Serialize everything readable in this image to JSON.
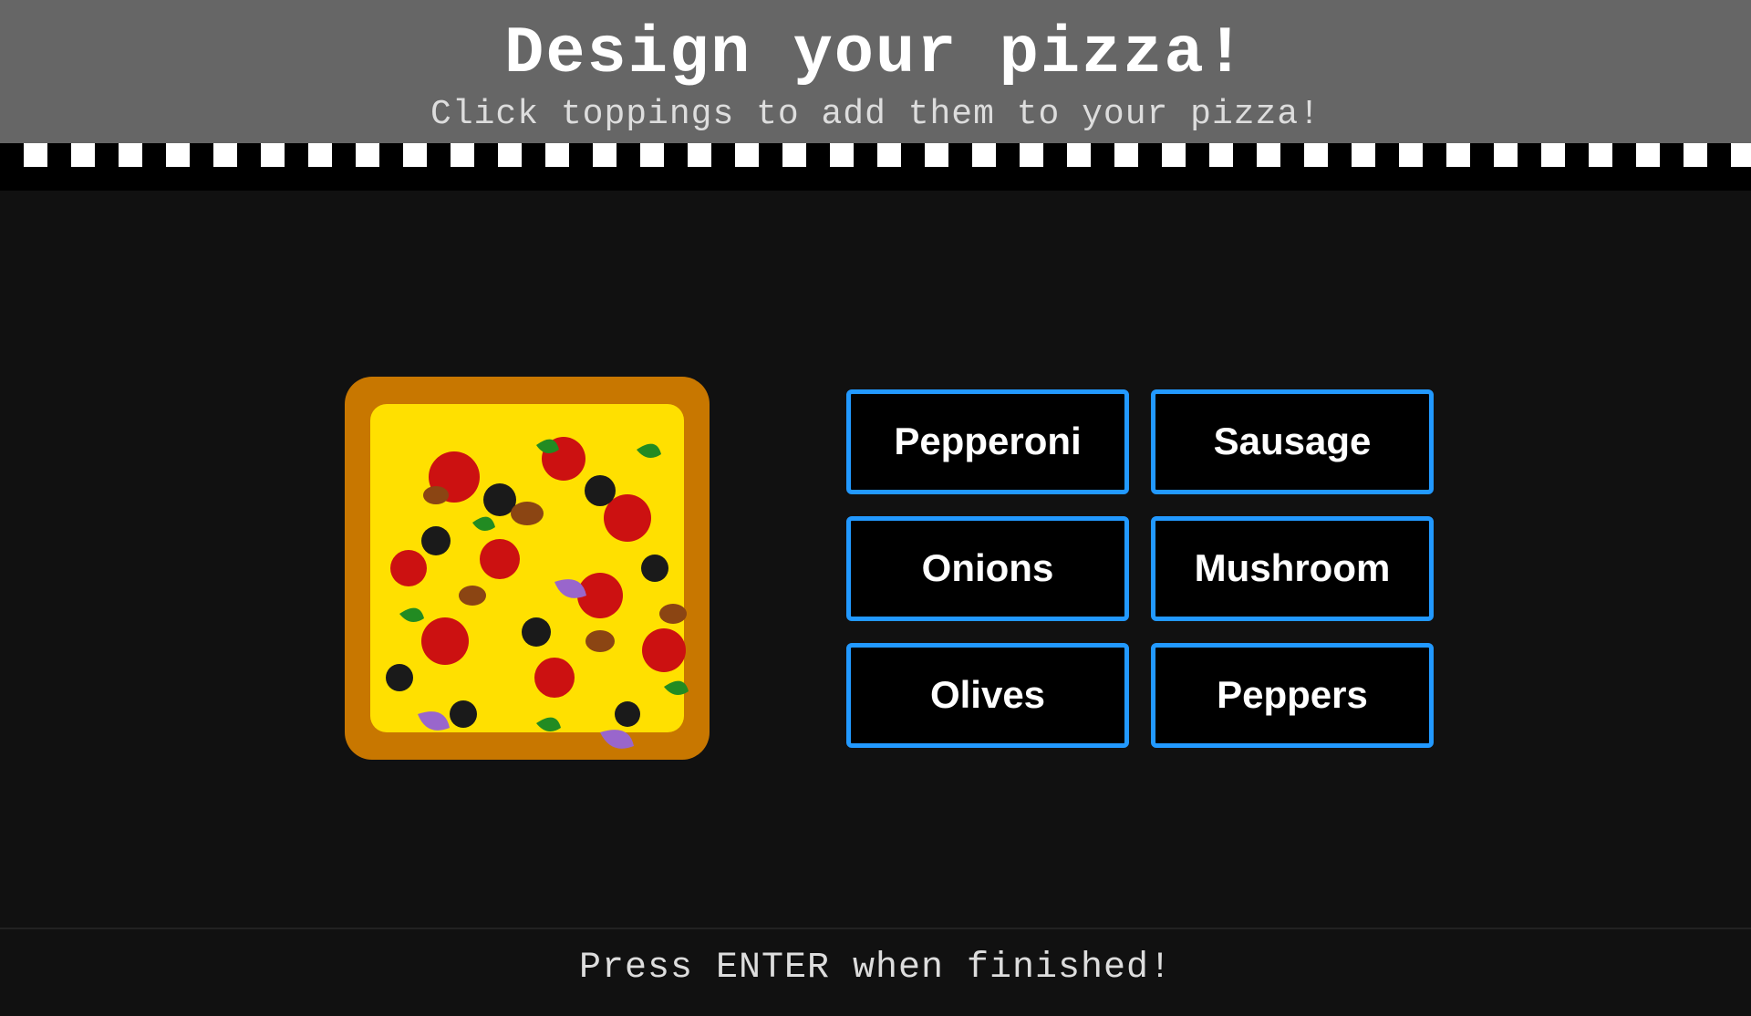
{
  "header": {
    "title": "Design your pizza!",
    "subtitle": "Click toppings to add them to your pizza!"
  },
  "toppings": {
    "buttons": [
      {
        "id": "pepperoni",
        "label": "Pepperoni"
      },
      {
        "id": "sausage",
        "label": "Sausage"
      },
      {
        "id": "onions",
        "label": "Onions"
      },
      {
        "id": "mushroom",
        "label": "Mushroom"
      },
      {
        "id": "olives",
        "label": "Olives"
      },
      {
        "id": "peppers",
        "label": "Peppers"
      }
    ]
  },
  "footer": {
    "prompt": "Press ENTER when finished!"
  },
  "colors": {
    "accent_blue": "#2299ff",
    "background": "#111111",
    "header_bg": "#666666",
    "checker_red": "#cc0000"
  }
}
